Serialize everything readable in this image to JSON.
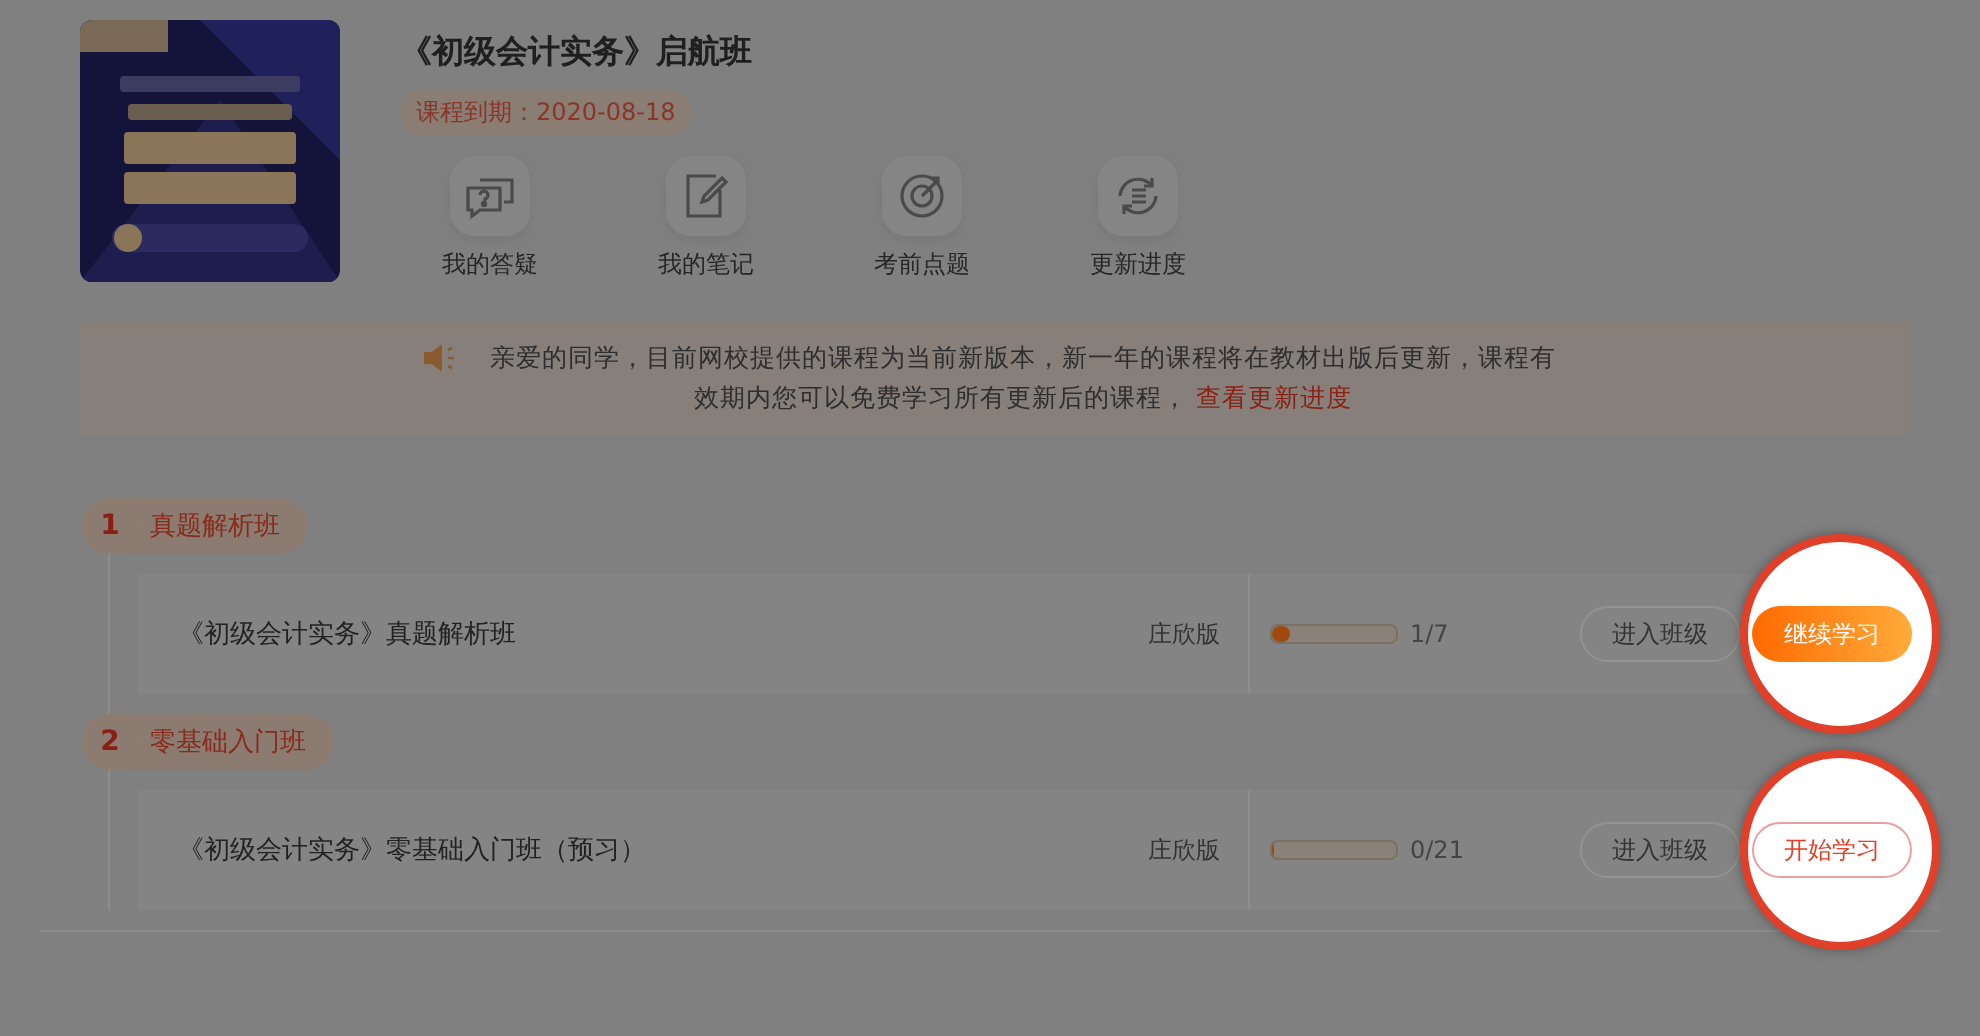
{
  "course": {
    "title": "《初级会计实务》启航班",
    "expiry": "课程到期：2020-08-18"
  },
  "tools": [
    {
      "kind": "qa",
      "label": "我的答疑"
    },
    {
      "kind": "note",
      "label": "我的笔记"
    },
    {
      "kind": "target",
      "label": "考前点题"
    },
    {
      "kind": "update",
      "label": "更新进度"
    }
  ],
  "notice": {
    "text": "亲爱的同学，目前网校提供的课程为当前新版本，新一年的课程将在教材出版后更新，课程有效期内您可以免费学习所有更新后的课程，",
    "link": "查看更新进度"
  },
  "sections": [
    {
      "number": "1",
      "name": "真题解析班",
      "classes": [
        {
          "title": "《初级会计实务》真题解析班",
          "teacher": "庄欣版",
          "level": 0.14,
          "progress": "1/7",
          "enter": "进入班级",
          "action": {
            "label": "继续学习",
            "kind": "primary",
            "highlighted": true
          }
        }
      ]
    },
    {
      "number": "2",
      "name": "零基础入门班",
      "classes": [
        {
          "title": "《初级会计实务》零基础入门班（预习）",
          "teacher": "庄欣版",
          "level": 0,
          "progress": "0/21",
          "enter": "进入班级",
          "action": {
            "label": "开始学习",
            "kind": "outline",
            "highlighted": true
          }
        }
      ]
    }
  ]
}
